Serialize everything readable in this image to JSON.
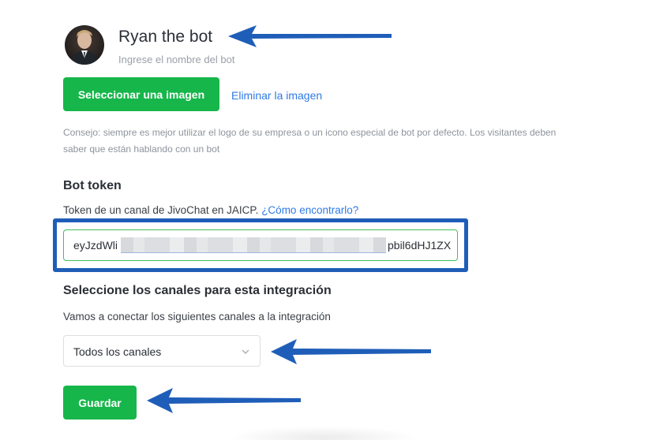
{
  "bot": {
    "name": "Ryan the bot",
    "name_hint": "Ingrese el nombre del bot",
    "avatar_icon": "profile-photo"
  },
  "image": {
    "select_label": "Seleccionar una imagen",
    "delete_label": "Eliminar la imagen",
    "tip": "Consejo: siempre es mejor utilizar el logo de su empresa o un icono especial de bot por defecto. Los visitantes deben saber que están hablando con un bot"
  },
  "token": {
    "title": "Bot token",
    "description": "Token de un canal de JivoChat en JAICP.",
    "help_link": "¿Cómo encontrarlo?",
    "value_start": "eyJzdWli",
    "value_end": "pbil6dHJ1ZX",
    "redacted": true
  },
  "channels": {
    "title": "Seleccione los canales para esta integración",
    "description": "Vamos a conectar los siguientes canales a la integración",
    "selected": "Todos los canales",
    "dropdown_icon": "chevron-down-icon"
  },
  "actions": {
    "save_label": "Guardar"
  },
  "colors": {
    "primary_green": "#16b64a",
    "link_blue": "#2f7ae5",
    "annotation_blue": "#1f5eb8",
    "input_focus_green": "#3fbf5c"
  }
}
